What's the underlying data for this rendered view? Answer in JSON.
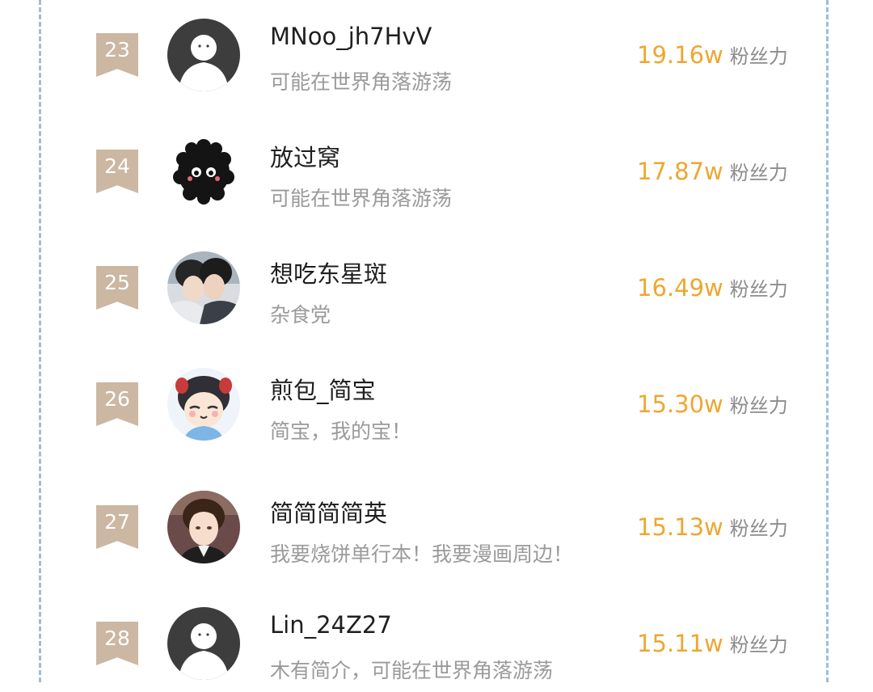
{
  "ranking": [
    {
      "rank": "23",
      "name": "MNoo_jh7HvV",
      "bio": "可能在世界角落游荡",
      "fans_value": "19.16w",
      "fans_unit": "粉丝力",
      "avatar": "default-avatar-icon"
    },
    {
      "rank": "24",
      "name": "放过窝",
      "bio": "可能在世界角落游荡",
      "fans_value": "17.87w",
      "fans_unit": "粉丝力",
      "avatar": "fluffy-black-creature"
    },
    {
      "rank": "25",
      "name": "想吃东星斑",
      "bio": "杂食党",
      "fans_value": "16.49w",
      "fans_unit": "粉丝力",
      "avatar": "anime-couple-illustration"
    },
    {
      "rank": "26",
      "name": "煎包_简宝",
      "bio": "简宝，我的宝！",
      "fans_value": "15.30w",
      "fans_unit": "粉丝力",
      "avatar": "chibi-character-illustration"
    },
    {
      "rank": "27",
      "name": "简简简简英",
      "bio": "我要烧饼单行本！我要漫画周边！",
      "fans_value": "15.13w",
      "fans_unit": "粉丝力",
      "avatar": "anime-man-portrait"
    },
    {
      "rank": "28",
      "name": "Lin_24Z27",
      "bio": "木有简介，可能在世界角落游荡",
      "fans_value": "15.11w",
      "fans_unit": "粉丝力",
      "avatar": "default-avatar-icon"
    }
  ],
  "colors": {
    "badge": "#cbb7a2",
    "fans_value": "#eda731",
    "bio": "#9a9a9a",
    "dashed_border": "#9cbfd3"
  }
}
